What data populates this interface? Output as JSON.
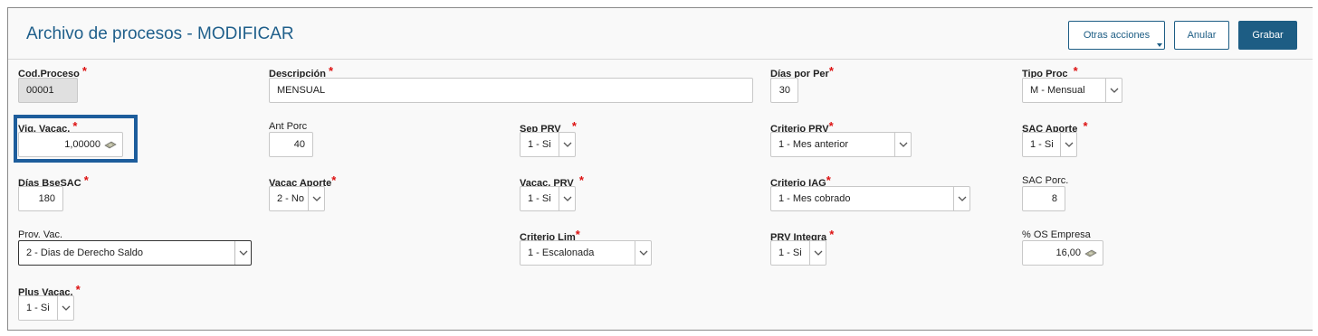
{
  "header": {
    "title": "Archivo de procesos - MODIFICAR",
    "buttons": {
      "otras": "Otras acciones",
      "anular": "Anular",
      "grabar": "Grabar"
    }
  },
  "fields": {
    "cod_proceso": {
      "label": "Cod.Proceso",
      "value": "00001"
    },
    "descripcion": {
      "label": "Descripción",
      "value": "MENSUAL"
    },
    "dias_por_per": {
      "label": "Días por Per",
      "value": "30"
    },
    "tipo_proc": {
      "label": "Tipo Proc",
      "value": "M - Mensual"
    },
    "vig_vacac": {
      "label": "Vig. Vacac.",
      "value": "1,00000"
    },
    "ant_porc": {
      "label": "Ant Porc",
      "value": "40"
    },
    "sep_prv": {
      "label": "Sep PRV",
      "value": "1 - Si"
    },
    "criterio_prv": {
      "label": "Criterio PRV",
      "value": "1 - Mes anterior"
    },
    "sac_aporte": {
      "label": "SAC Aporte",
      "value": "1 - Si"
    },
    "dias_bsesac": {
      "label": "Días BseSAC",
      "value": "180"
    },
    "vacac_aporte": {
      "label": "Vacac Aporte",
      "value": "2 - No"
    },
    "vacac_prv": {
      "label": "Vacac. PRV",
      "value": "1 - Si"
    },
    "criterio_iag": {
      "label": "Criterio IAG",
      "value": "1 - Mes cobrado"
    },
    "sac_porc": {
      "label": "SAC Porc.",
      "value": "8"
    },
    "prov_vac": {
      "label": "Prov. Vac.",
      "value": "2 - Dias de Derecho Saldo"
    },
    "criterio_lim": {
      "label": "Criterio Lim",
      "value": "1 - Escalonada"
    },
    "prv_integra": {
      "label": "PRV Integra",
      "value": "1 - Si"
    },
    "os_empresa": {
      "label": "% OS Empresa",
      "value": "16,00"
    },
    "plus_vacac": {
      "label": "Plus Vacac.",
      "value": "1 - Si"
    }
  },
  "required_mark": "*",
  "colors": {
    "accent": "#1d5d84",
    "required": "#dd1111",
    "title": "#1f5f8b"
  }
}
